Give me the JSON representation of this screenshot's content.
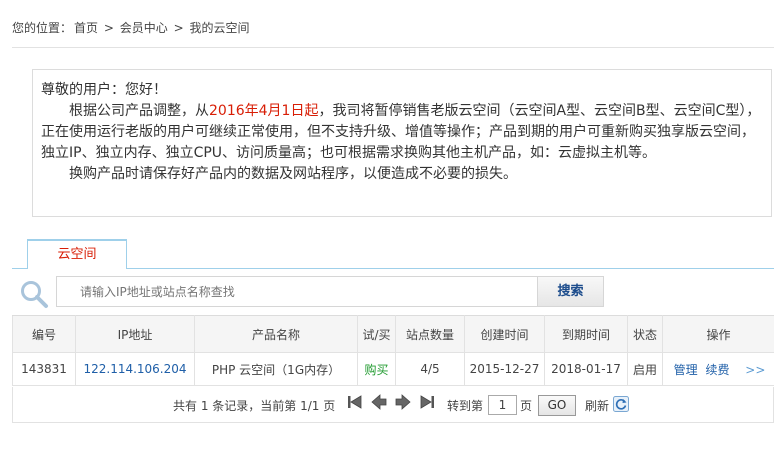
{
  "breadcrumb": {
    "prefix": "您的位置：",
    "home": "首页",
    "sep": ">",
    "member": "会员中心",
    "current": "我的云空间"
  },
  "notice": {
    "greeting": "尊敬的用户：您好！",
    "para1_before": "根据公司产品调整，从",
    "para1_date": "2016年4月1日起",
    "para1_after": "，我司将暂停销售老版云空间（云空间A型、云空间B型、云空间C型），正在使用运行老版的用户可继续正常使用，但不支持升级、增值等操作；产品到期的用户可重新购买独享版云空间，独立IP、独立内存、独立CPU、访问质量高；也可根据需求换购其他主机产品，如：云虚拟主机等。",
    "para2": "换购产品时请保存好产品内的数据及网站程序，以便造成不必要的损失。"
  },
  "tabs": [
    {
      "label": "云空间",
      "active": true
    }
  ],
  "search": {
    "placeholder": "请输入IP地址或站点名称查找",
    "button_label": "搜索"
  },
  "table": {
    "headers": [
      "编号",
      "IP地址",
      "产品名称",
      "试/买",
      "站点数量",
      "创建时间",
      "到期时间",
      "状态",
      "操作"
    ],
    "rows": [
      {
        "id": "143831",
        "ip": "122.114.106.204",
        "product": "PHP 云空间（1G内存）",
        "trial_buy": "购买",
        "sites": "4/5",
        "created": "2015-12-27",
        "expires": "2018-01-17",
        "status": "启用",
        "op_manage": "管理",
        "op_renew": "续费",
        "op_more": ">>"
      }
    ]
  },
  "pager": {
    "summary": "共有 1 条记录，当前第 1/1 页",
    "goto_label": "转到第",
    "page_value": "1",
    "page_unit": "页",
    "go_label": "GO",
    "refresh_label": "刷新"
  },
  "colors": {
    "accent_red": "#d81e06",
    "link_blue": "#1f5fa8",
    "buy_green": "#1f9a2e",
    "tab_border": "#9fd0ea"
  }
}
